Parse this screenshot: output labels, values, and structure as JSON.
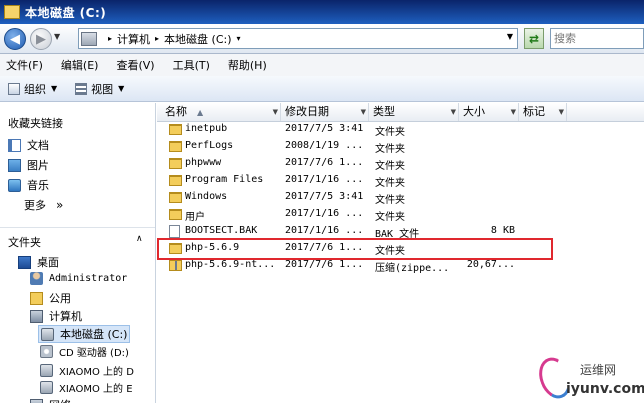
{
  "window": {
    "title": "本地磁盘 (C:)"
  },
  "address": {
    "crumbs": [
      "计算机",
      "本地磁盘 (C:)"
    ],
    "search_placeholder": "搜索"
  },
  "menu": [
    "文件(F)",
    "编辑(E)",
    "查看(V)",
    "工具(T)",
    "帮助(H)"
  ],
  "toolbar": {
    "organize": "组织",
    "view": "视图"
  },
  "nav": {
    "favorites_header": "收藏夹链接",
    "favorites": [
      "文档",
      "图片",
      "音乐"
    ],
    "more": "更多",
    "more_arrow": "»",
    "folders_header": "文件夹",
    "tree": [
      {
        "label": "桌面",
        "icon": "desktop-icon"
      },
      {
        "label": "Administrator",
        "icon": "user-folder-icon"
      },
      {
        "label": "公用",
        "icon": "folder-icon"
      },
      {
        "label": "计算机",
        "icon": "computer-icon"
      },
      {
        "label": "本地磁盘 (C:)",
        "icon": "drive-icon",
        "selected": true
      },
      {
        "label": "CD 驱动器 (D:)",
        "icon": "cd-drive-icon"
      },
      {
        "label": "XIAOMO 上的 D",
        "icon": "network-drive-icon"
      },
      {
        "label": "XIAOMO 上的 E",
        "icon": "network-drive-icon"
      },
      {
        "label": "网络",
        "icon": "network-icon"
      }
    ]
  },
  "columns": [
    "名称",
    "修改日期",
    "类型",
    "大小",
    "标记"
  ],
  "files": [
    {
      "name": "inetpub",
      "date": "2017/7/5 3:41",
      "type": "文件夹",
      "size": "",
      "icon": "folder"
    },
    {
      "name": "PerfLogs",
      "date": "2008/1/19 ...",
      "type": "文件夹",
      "size": "",
      "icon": "folder"
    },
    {
      "name": "phpwww",
      "date": "2017/7/6 1...",
      "type": "文件夹",
      "size": "",
      "icon": "folder"
    },
    {
      "name": "Program Files",
      "date": "2017/1/16 ...",
      "type": "文件夹",
      "size": "",
      "icon": "folder"
    },
    {
      "name": "Windows",
      "date": "2017/7/5 3:41",
      "type": "文件夹",
      "size": "",
      "icon": "folder"
    },
    {
      "name": "用户",
      "date": "2017/1/16 ...",
      "type": "文件夹",
      "size": "",
      "icon": "folder"
    },
    {
      "name": "BOOTSECT.BAK",
      "date": "2017/1/16 ...",
      "type": "BAK 文件",
      "size": "8 KB",
      "icon": "bak"
    },
    {
      "name": "php-5.6.9",
      "date": "2017/7/6 1...",
      "type": "文件夹",
      "size": "",
      "icon": "folder"
    },
    {
      "name": "php-5.6.9-nt...",
      "date": "2017/7/6 1...",
      "type": "压缩(zippe...",
      "size": "20,67...",
      "icon": "zip"
    }
  ],
  "watermark": {
    "line1": "运维网",
    "line2": "iyunv.com"
  },
  "colors": {
    "highlight": "#e0282e",
    "title_bar": "#0a246a"
  }
}
